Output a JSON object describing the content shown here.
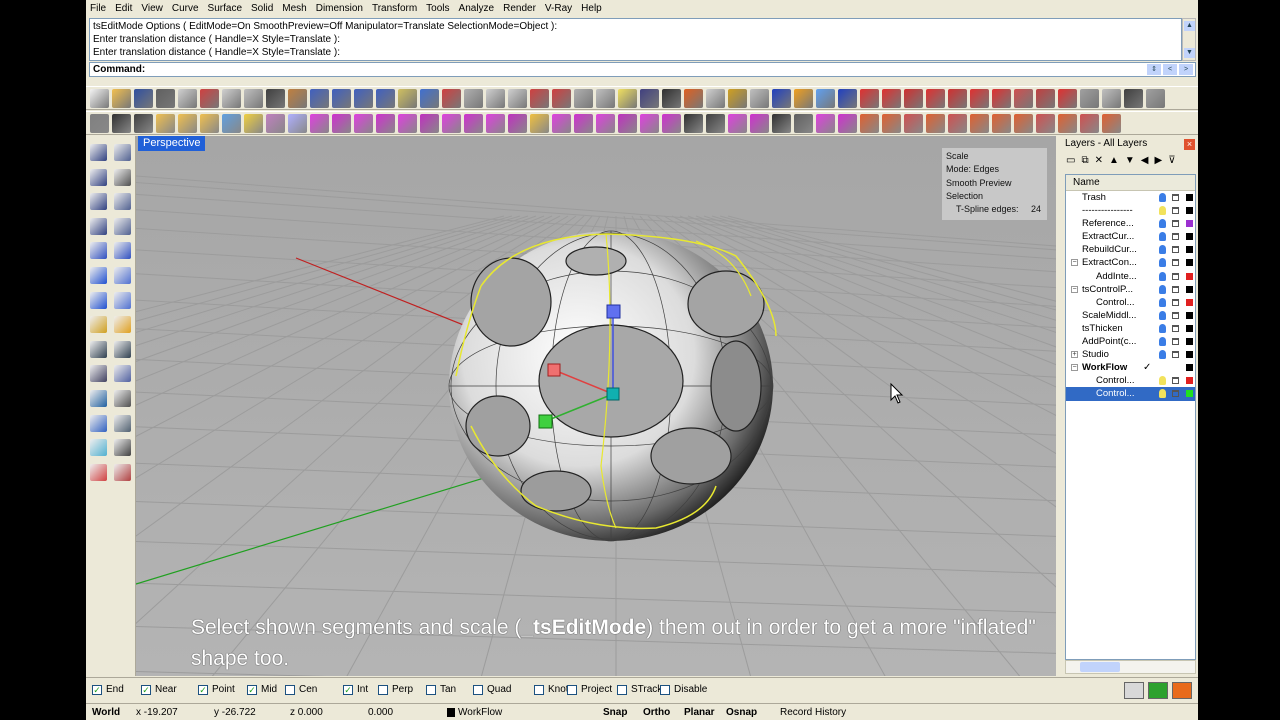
{
  "menu": [
    "File",
    "Edit",
    "View",
    "Curve",
    "Surface",
    "Solid",
    "Mesh",
    "Dimension",
    "Transform",
    "Tools",
    "Analyze",
    "Render",
    "V-Ray",
    "Help"
  ],
  "history": [
    "tsEditMode Options ( EditMode=On  SmoothPreview=Off  Manipulator=Translate  SelectionMode=Object ):",
    "Enter translation distance ( Handle=X  Style=Translate ):",
    "Enter translation distance ( Handle=X  Style=Translate ):"
  ],
  "command": {
    "label": "Command:",
    "value": ""
  },
  "viewport": {
    "title": "Perspective",
    "info": {
      "l1": "Scale",
      "l2": "Mode:  Edges",
      "l3": "Smooth Preview",
      "l4": "Selection",
      "l5": "T-Spline edges:",
      "l5v": "24"
    }
  },
  "caption": {
    "pre": "Select shown segments and scale (",
    "bold": "_tsEditMode",
    "post": ") them out in order to get a more \"inflated\" shape too."
  },
  "layers": {
    "title": "Layers - All Layers",
    "column_name": "Name",
    "rows": [
      {
        "name": "Trash",
        "indent": false,
        "exp": "",
        "bulb": "on",
        "color": "#000000"
      },
      {
        "name": "----------------",
        "indent": false,
        "exp": "",
        "bulb": "off",
        "color": "#000000"
      },
      {
        "name": "Reference...",
        "indent": false,
        "exp": "",
        "bulb": "on",
        "color": "#9b30d0"
      },
      {
        "name": "ExtractCur...",
        "indent": false,
        "exp": "",
        "bulb": "on",
        "color": "#000000"
      },
      {
        "name": "RebuildCur...",
        "indent": false,
        "exp": "",
        "bulb": "on",
        "color": "#000000"
      },
      {
        "name": "ExtractCon...",
        "indent": false,
        "exp": "−",
        "bulb": "on",
        "color": "#000000"
      },
      {
        "name": "AddInte...",
        "indent": true,
        "exp": "",
        "bulb": "on",
        "color": "#e02020"
      },
      {
        "name": "tsControlP...",
        "indent": false,
        "exp": "−",
        "bulb": "on",
        "color": "#000000"
      },
      {
        "name": "Control...",
        "indent": true,
        "exp": "",
        "bulb": "on",
        "color": "#e02020"
      },
      {
        "name": "ScaleMiddl...",
        "indent": false,
        "exp": "",
        "bulb": "on",
        "color": "#000000"
      },
      {
        "name": "tsThicken",
        "indent": false,
        "exp": "",
        "bulb": "on",
        "color": "#000000"
      },
      {
        "name": "AddPoint(c...",
        "indent": false,
        "exp": "",
        "bulb": "on",
        "color": "#000000"
      },
      {
        "name": "Studio",
        "indent": false,
        "exp": "+",
        "bulb": "on",
        "color": "#000000"
      },
      {
        "name": "WorkFlow",
        "indent": false,
        "exp": "−",
        "bulb": "none",
        "color": "#000000",
        "current": true
      },
      {
        "name": "Control...",
        "indent": true,
        "exp": "",
        "bulb": "off",
        "color": "#e02020"
      },
      {
        "name": "Control...",
        "indent": true,
        "exp": "",
        "bulb": "off",
        "color": "#20e020",
        "selected": true
      }
    ]
  },
  "osnaps": [
    {
      "label": "End",
      "checked": true
    },
    {
      "label": "Near",
      "checked": true
    },
    {
      "label": "Point",
      "checked": true
    },
    {
      "label": "Mid",
      "checked": true
    },
    {
      "label": "Cen",
      "checked": false
    },
    {
      "label": "Int",
      "checked": true
    },
    {
      "label": "Perp",
      "checked": false
    },
    {
      "label": "Tan",
      "checked": false
    },
    {
      "label": "Quad",
      "checked": false
    },
    {
      "label": "Knot",
      "checked": false
    },
    {
      "label": "Project",
      "checked": false
    },
    {
      "label": "STrack",
      "checked": false
    },
    {
      "label": "Disable",
      "checked": false
    }
  ],
  "status": {
    "cplane": "World",
    "x": "x -19.207",
    "y": "y -26.722",
    "z": "z 0.000",
    "dist": "0.000",
    "layer": "WorkFlow",
    "snap": "Snap",
    "ortho": "Ortho",
    "planar": "Planar",
    "osnap": "Osnap",
    "record": "Record History"
  },
  "colors": {
    "axis_x": "#c02020",
    "axis_y": "#20a020",
    "selection": "#e8e830",
    "viewport_bg": "#a8a8a8"
  }
}
